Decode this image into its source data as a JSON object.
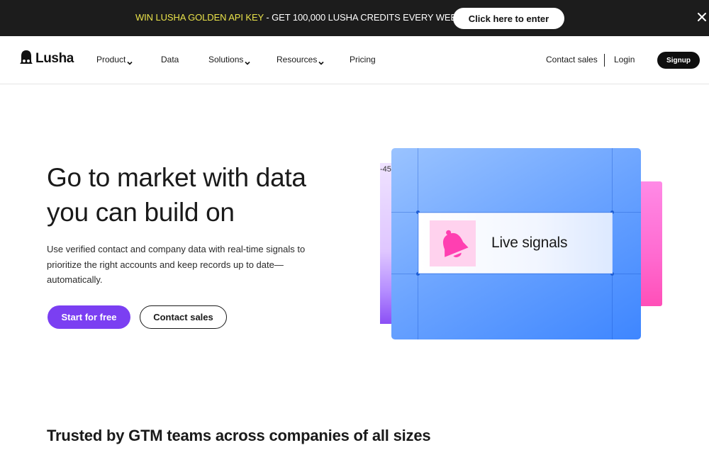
{
  "banner": {
    "highlight": "WIN LUSHA GOLDEN API KEY",
    "text": " - GET 100,000 LUSHA CREDITS EVERY WEEK!",
    "cta": "Click here to enter",
    "colors": {
      "background": "#1c1c1c",
      "highlight": "#e9e24a"
    }
  },
  "nav": {
    "logo": "Lusha",
    "items": [
      {
        "label": "Product",
        "dropdown": true
      },
      {
        "label": "Data",
        "dropdown": false
      },
      {
        "label": "Solutions",
        "dropdown": true
      },
      {
        "label": "Resources",
        "dropdown": true
      },
      {
        "label": "Pricing",
        "dropdown": false
      }
    ],
    "contact_sales": "Contact sales",
    "login": "Login",
    "signup": "Signup"
  },
  "hero": {
    "title_line1": "Go to market with data",
    "title_line2": "you can build on",
    "subtitle": "Use verified contact and company data with real-time signals to prioritize the right accounts and keep records up to date—automatically.",
    "primary_cta": "Start for free",
    "secondary_cta": "Contact sales",
    "colors": {
      "primary": "#7b3ff2"
    }
  },
  "illustration": {
    "back_number": "-45",
    "signal_label": "Live signals",
    "icon": "bell-icon"
  },
  "trusted": {
    "heading": "Trusted by GTM teams across companies of all sizes"
  }
}
